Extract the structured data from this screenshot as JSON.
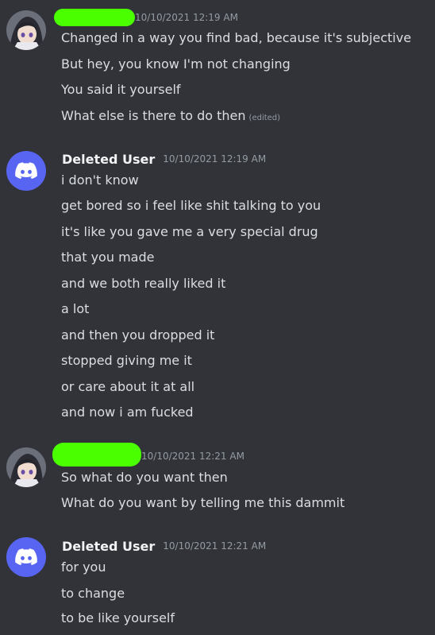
{
  "messages": [
    {
      "author": "",
      "author_redacted": true,
      "timestamp": "10/10/2021 12:19 AM",
      "lines": [
        "Changed in a way you find bad, because it's subjective",
        "But hey, you know I'm not changing",
        "You said it yourself",
        "What else is there to do then"
      ],
      "edited_label": "(edited)"
    },
    {
      "author": "Deleted User",
      "timestamp": "10/10/2021 12:19 AM",
      "lines": [
        "i don't know",
        "get bored so i feel like shit talking to you",
        "it's like you gave me a very special drug",
        "that you made",
        "and we both really liked it",
        "a lot",
        "and then you dropped it",
        "stopped giving me it",
        "or care about it at all",
        "and now i am fucked"
      ]
    },
    {
      "author": "",
      "author_redacted": true,
      "timestamp": "10/10/2021 12:21 AM",
      "lines": [
        "So what do you want then",
        "What do you want by telling me this dammit"
      ]
    },
    {
      "author": "Deleted User",
      "timestamp": "10/10/2021 12:21 AM",
      "lines": [
        "for you",
        "to change",
        "to be like yourself"
      ]
    }
  ],
  "colors": {
    "background": "#313338",
    "text": "#dbdee1",
    "username": "#f2f3f5",
    "muted": "#949ba4",
    "discord_blurple": "#5865f2",
    "redaction": "#4aff00"
  },
  "icons": {
    "anime_avatar": "anime-avatar-icon",
    "discord_avatar": "discord-logo-icon"
  }
}
